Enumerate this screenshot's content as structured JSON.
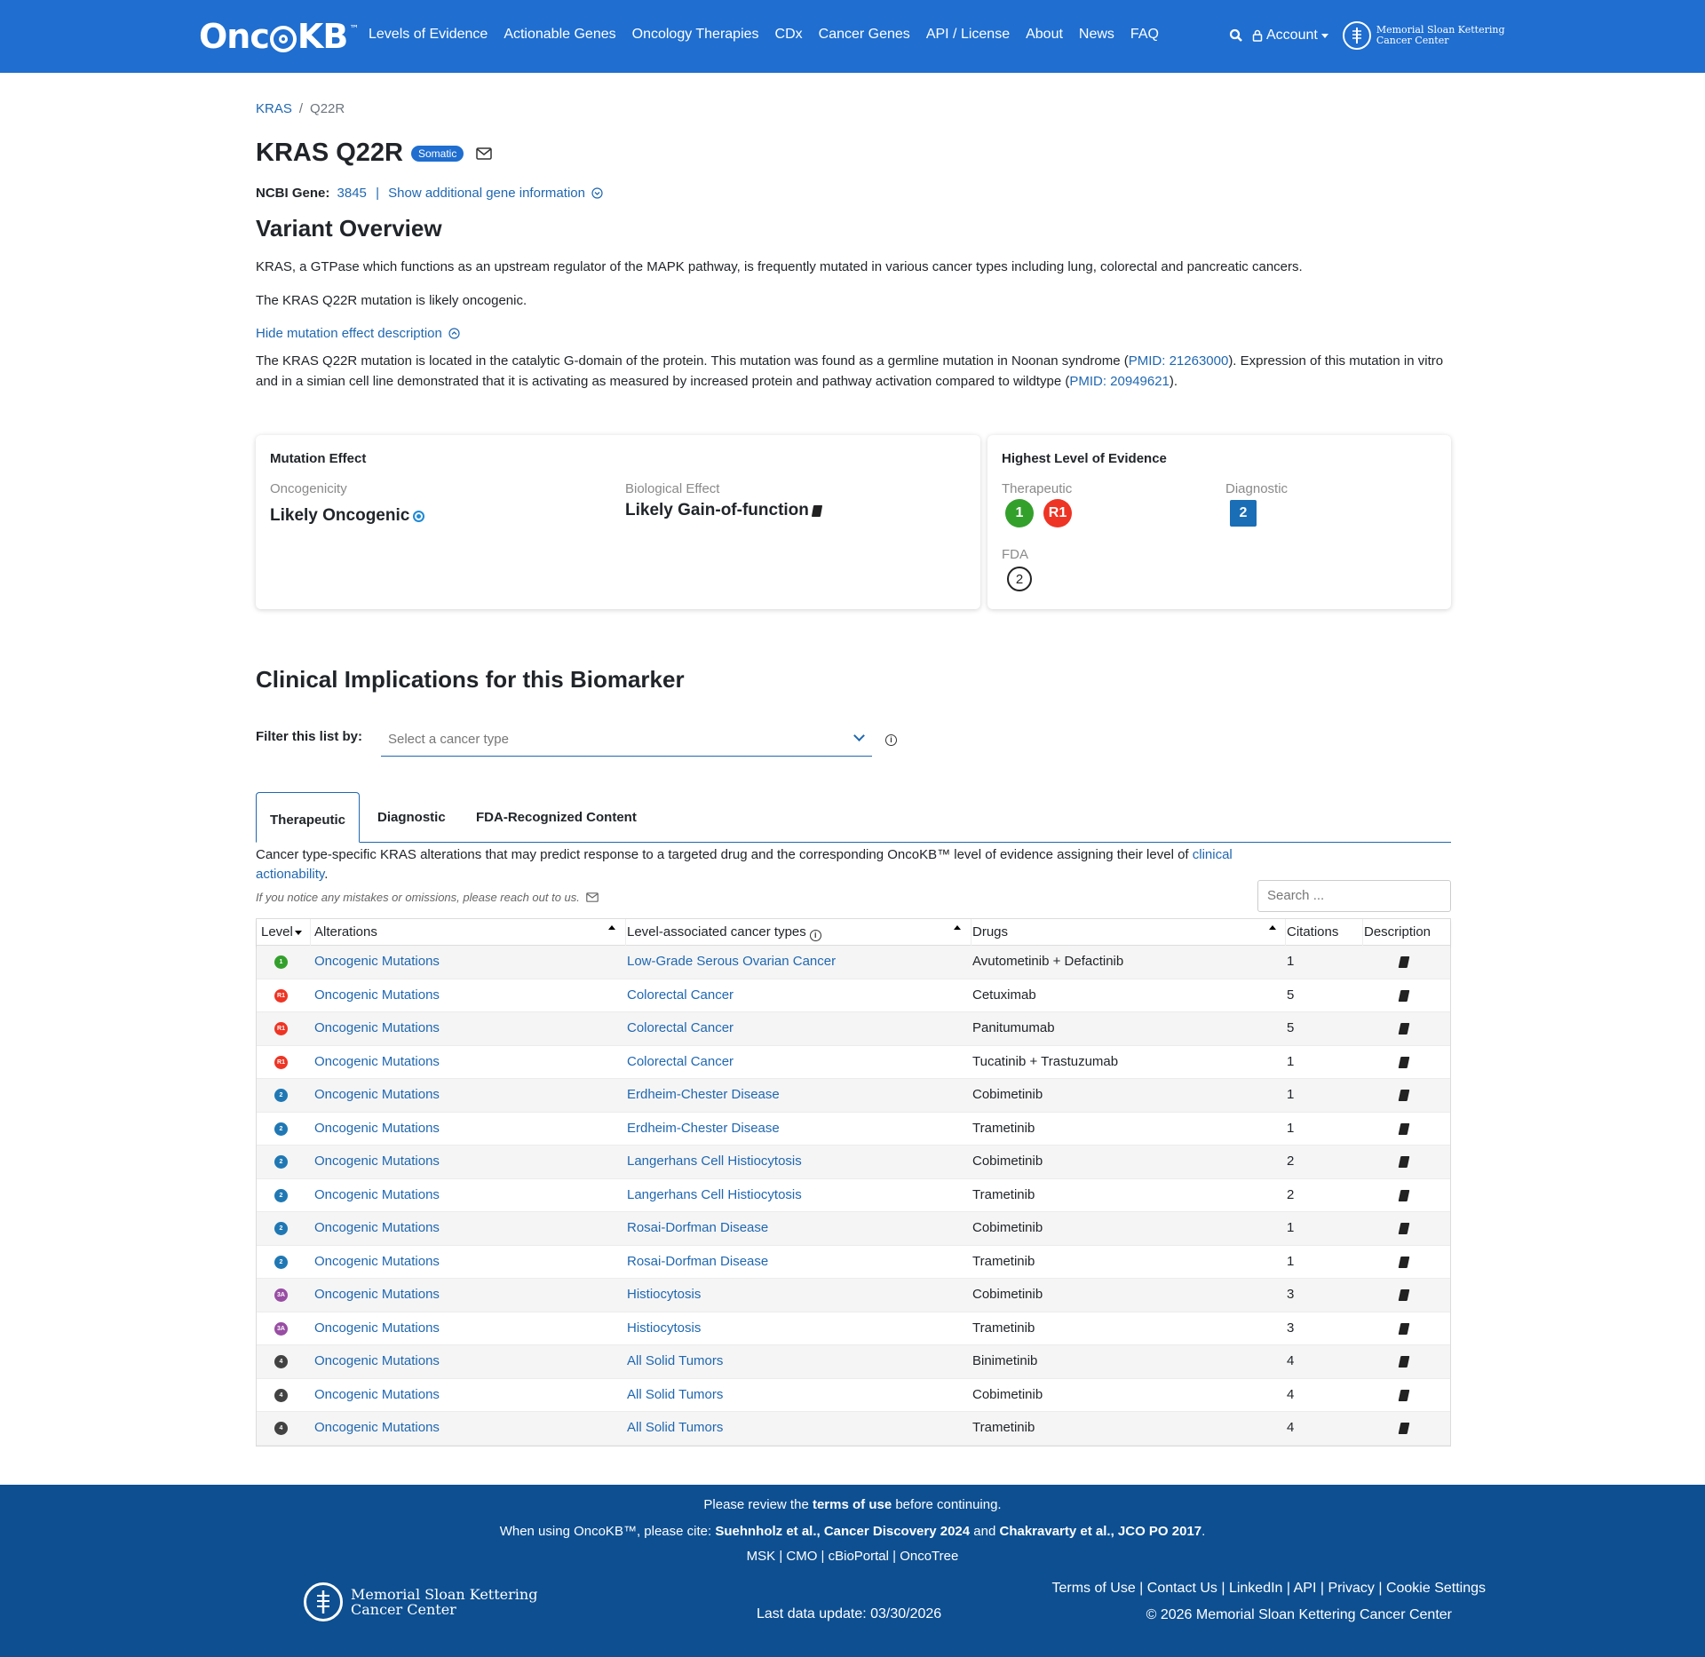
{
  "nav": {
    "logo_text": "OncoKB",
    "logo_tm": "™",
    "links": [
      "Levels of Evidence",
      "Actionable Genes",
      "Oncology Therapies",
      "CDx",
      "Cancer Genes",
      "API / License",
      "About",
      "News",
      "FAQ"
    ],
    "account_label": "Account",
    "msk_line1": "Memorial Sloan Kettering",
    "msk_line2": "Cancer Center"
  },
  "breadcrumb": {
    "gene": "KRAS",
    "sep": "/",
    "variant": "Q22R"
  },
  "title": "KRAS Q22R",
  "badge": "Somatic",
  "ncbi": {
    "label": "NCBI Gene:",
    "id": "3845",
    "sep": "|",
    "more": "Show additional gene information"
  },
  "variant_overview": {
    "heading": "Variant Overview",
    "summary": "KRAS, a GTPase which functions as an upstream regulator of the MAPK pathway, is frequently mutated in various cancer types including lung, colorectal and pancreatic cancers.",
    "oncogenic_text": "The KRAS Q22R mutation is likely oncogenic.",
    "hide_link": "Hide mutation effect description",
    "desc_a": "The KRAS Q22R mutation is located in the catalytic G-domain of the protein. This mutation was found as a germline mutation in Noonan syndrome (",
    "pmid1": "PMID: 21263000",
    "desc_b": "). Expression of this mutation in vitro and in a simian cell line demonstrated that it is activating as measured by increased protein and pathway activation compared to wildtype (",
    "pmid2": "PMID: 20949621",
    "desc_c": ")."
  },
  "mutation_effect": {
    "title": "Mutation Effect",
    "oncogenicity_label": "Oncogenicity",
    "oncogenicity_value": "Likely Oncogenic",
    "bio_label": "Biological Effect",
    "bio_value": "Likely Gain-of-function"
  },
  "highest_level": {
    "title": "Highest Level of Evidence",
    "therapeutic_label": "Therapeutic",
    "therapeutic_levels": [
      "1",
      "R1"
    ],
    "diagnostic_label": "Diagnostic",
    "diagnostic_level": "2",
    "fda_label": "FDA",
    "fda_level": "2"
  },
  "clinical": {
    "heading": "Clinical Implications for this Biomarker",
    "filter_label": "Filter this list by:",
    "select_placeholder": "Select a cancer type",
    "tabs": [
      "Therapeutic",
      "Diagnostic",
      "FDA-Recognized Content"
    ],
    "desc_a": "Cancer type-specific KRAS alterations that may predict response to a targeted drug and the corresponding OncoKB™ level of evidence assigning their level of ",
    "desc_link": "clinical actionability",
    "desc_b": ".",
    "mistakes": "If you notice any mistakes or omissions, please reach out to us.",
    "search_placeholder": "Search ..."
  },
  "colors": {
    "level_1": "#33a02c",
    "level_R1": "#ee3424",
    "level_2": "#1f78b4",
    "level_3A": "#984ea3",
    "level_4": "#424242"
  },
  "table": {
    "headers": [
      "Level",
      "Alterations",
      "Level-associated cancer types",
      "Drugs",
      "Citations",
      "Description"
    ],
    "rows": [
      {
        "level": "1",
        "alteration": "Oncogenic Mutations",
        "cancer": "Low-Grade Serous Ovarian Cancer",
        "drug": "Avutometinib + Defactinib",
        "citations": "1"
      },
      {
        "level": "R1",
        "alteration": "Oncogenic Mutations",
        "cancer": "Colorectal Cancer",
        "drug": "Cetuximab",
        "citations": "5"
      },
      {
        "level": "R1",
        "alteration": "Oncogenic Mutations",
        "cancer": "Colorectal Cancer",
        "drug": "Panitumumab",
        "citations": "5"
      },
      {
        "level": "R1",
        "alteration": "Oncogenic Mutations",
        "cancer": "Colorectal Cancer",
        "drug": "Tucatinib + Trastuzumab",
        "citations": "1"
      },
      {
        "level": "2",
        "alteration": "Oncogenic Mutations",
        "cancer": "Erdheim-Chester Disease",
        "drug": "Cobimetinib",
        "citations": "1"
      },
      {
        "level": "2",
        "alteration": "Oncogenic Mutations",
        "cancer": "Erdheim-Chester Disease",
        "drug": "Trametinib",
        "citations": "1"
      },
      {
        "level": "2",
        "alteration": "Oncogenic Mutations",
        "cancer": "Langerhans Cell Histiocytosis",
        "drug": "Cobimetinib",
        "citations": "2"
      },
      {
        "level": "2",
        "alteration": "Oncogenic Mutations",
        "cancer": "Langerhans Cell Histiocytosis",
        "drug": "Trametinib",
        "citations": "2"
      },
      {
        "level": "2",
        "alteration": "Oncogenic Mutations",
        "cancer": "Rosai-Dorfman Disease",
        "drug": "Cobimetinib",
        "citations": "1"
      },
      {
        "level": "2",
        "alteration": "Oncogenic Mutations",
        "cancer": "Rosai-Dorfman Disease",
        "drug": "Trametinib",
        "citations": "1"
      },
      {
        "level": "3A",
        "alteration": "Oncogenic Mutations",
        "cancer": "Histiocytosis",
        "drug": "Cobimetinib",
        "citations": "3"
      },
      {
        "level": "3A",
        "alteration": "Oncogenic Mutations",
        "cancer": "Histiocytosis",
        "drug": "Trametinib",
        "citations": "3"
      },
      {
        "level": "4",
        "alteration": "Oncogenic Mutations",
        "cancer": "All Solid Tumors",
        "drug": "Binimetinib",
        "citations": "4"
      },
      {
        "level": "4",
        "alteration": "Oncogenic Mutations",
        "cancer": "All Solid Tumors",
        "drug": "Cobimetinib",
        "citations": "4"
      },
      {
        "level": "4",
        "alteration": "Oncogenic Mutations",
        "cancer": "All Solid Tumors",
        "drug": "Trametinib",
        "citations": "4"
      }
    ]
  },
  "footer": {
    "review_a": "Please review the ",
    "review_b": "terms of use",
    "review_c": " before continuing.",
    "cite_a": "When using OncoKB™, please cite: ",
    "cite_b": "Suehnholz et al., Cancer Discovery 2024",
    "cite_c": " and ",
    "cite_d": "Chakravarty et al., JCO PO 2017",
    "cite_e": ".",
    "partners": "MSK | CMO | cBioPortal | OncoTree",
    "last_update": "Last data update: 03/30/2026",
    "links": "Terms of Use | Contact Us | LinkedIn | API | Privacy | Cookie Settings",
    "copyright": "© 2026 Memorial Sloan Kettering Cancer Center",
    "msk_line1": "Memorial Sloan Kettering",
    "msk_line2": "Cancer Center"
  }
}
